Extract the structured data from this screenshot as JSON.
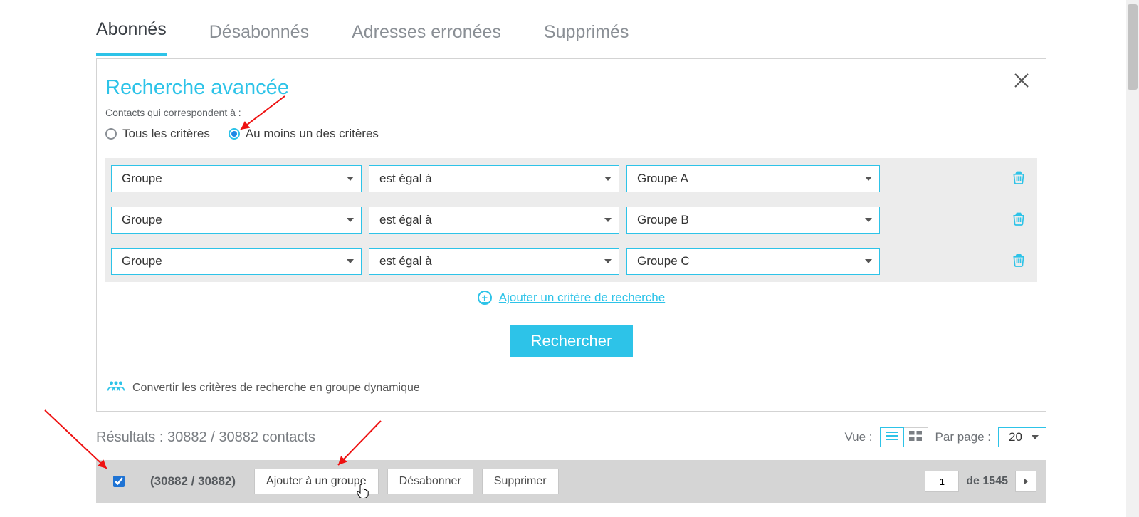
{
  "tabs": {
    "subscribed": "Abonnés",
    "unsubscribed": "Désabonnés",
    "bounced": "Adresses erronées",
    "deleted": "Supprimés"
  },
  "panel": {
    "title": "Recherche avancée",
    "matchLabel": "Contacts qui correspondent à :",
    "radio_all": "Tous les critères",
    "radio_any": "Au moins un des critères",
    "rows": [
      {
        "field": "Groupe",
        "operator": "est égal à",
        "value": "Groupe A"
      },
      {
        "field": "Groupe",
        "operator": "est égal à",
        "value": "Groupe B"
      },
      {
        "field": "Groupe",
        "operator": "est égal à",
        "value": "Groupe C"
      }
    ],
    "add_criterion": "Ajouter un critère de recherche",
    "search_button": "Rechercher",
    "convert_link": "Convertir les critères de recherche en groupe dynamique"
  },
  "results": {
    "text": "Résultats : 30882 / 30882 contacts",
    "view_label": "Vue :",
    "per_page_label": "Par page :",
    "per_page_value": "20"
  },
  "actionbar": {
    "selected": "(30882 / 30882)",
    "add_to_group": "Ajouter à un groupe",
    "unsubscribe": "Désabonner",
    "delete": "Supprimer",
    "page": "1",
    "of": "de 1545"
  }
}
